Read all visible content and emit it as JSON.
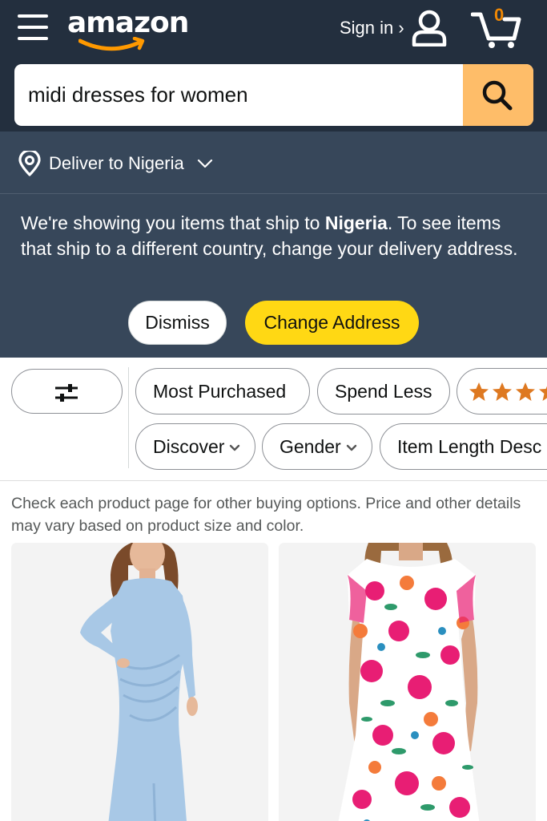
{
  "header": {
    "logo_text": "amazon",
    "sign_in_label": "Sign in ›",
    "cart_count": "0",
    "colors": {
      "bar": "#232f3e",
      "search_button": "#febd69",
      "cart_count": "#f08804"
    }
  },
  "search": {
    "value": "midi dresses for women",
    "button_icon": "search-icon"
  },
  "delivery": {
    "label": "Deliver to Nigeria",
    "icon": "location-pin-icon"
  },
  "notice": {
    "text_before": "We're showing you items that ship to ",
    "country": "Nigeria",
    "text_after": ". To see items that ship to a different country, change your delivery address.",
    "dismiss_label": "Dismiss",
    "change_address_label": "Change Address",
    "colors": {
      "background": "#37475a",
      "primary_button": "#ffd814"
    }
  },
  "filters": {
    "filter_button_icon": "sliders-icon",
    "row1": [
      "Most Purchased",
      "Spend Less"
    ],
    "row2": [
      "Discover",
      "Gender",
      "Item Length Desc"
    ],
    "rating_pill_icon": "stars-icon"
  },
  "results": {
    "note": "Check each product page for other buying options. Price and other details may vary based on product size and color.",
    "products": [
      {
        "image": "light blue long-sleeve wrap midi dress"
      },
      {
        "image": "floral print short-sleeve midi dress"
      }
    ]
  }
}
